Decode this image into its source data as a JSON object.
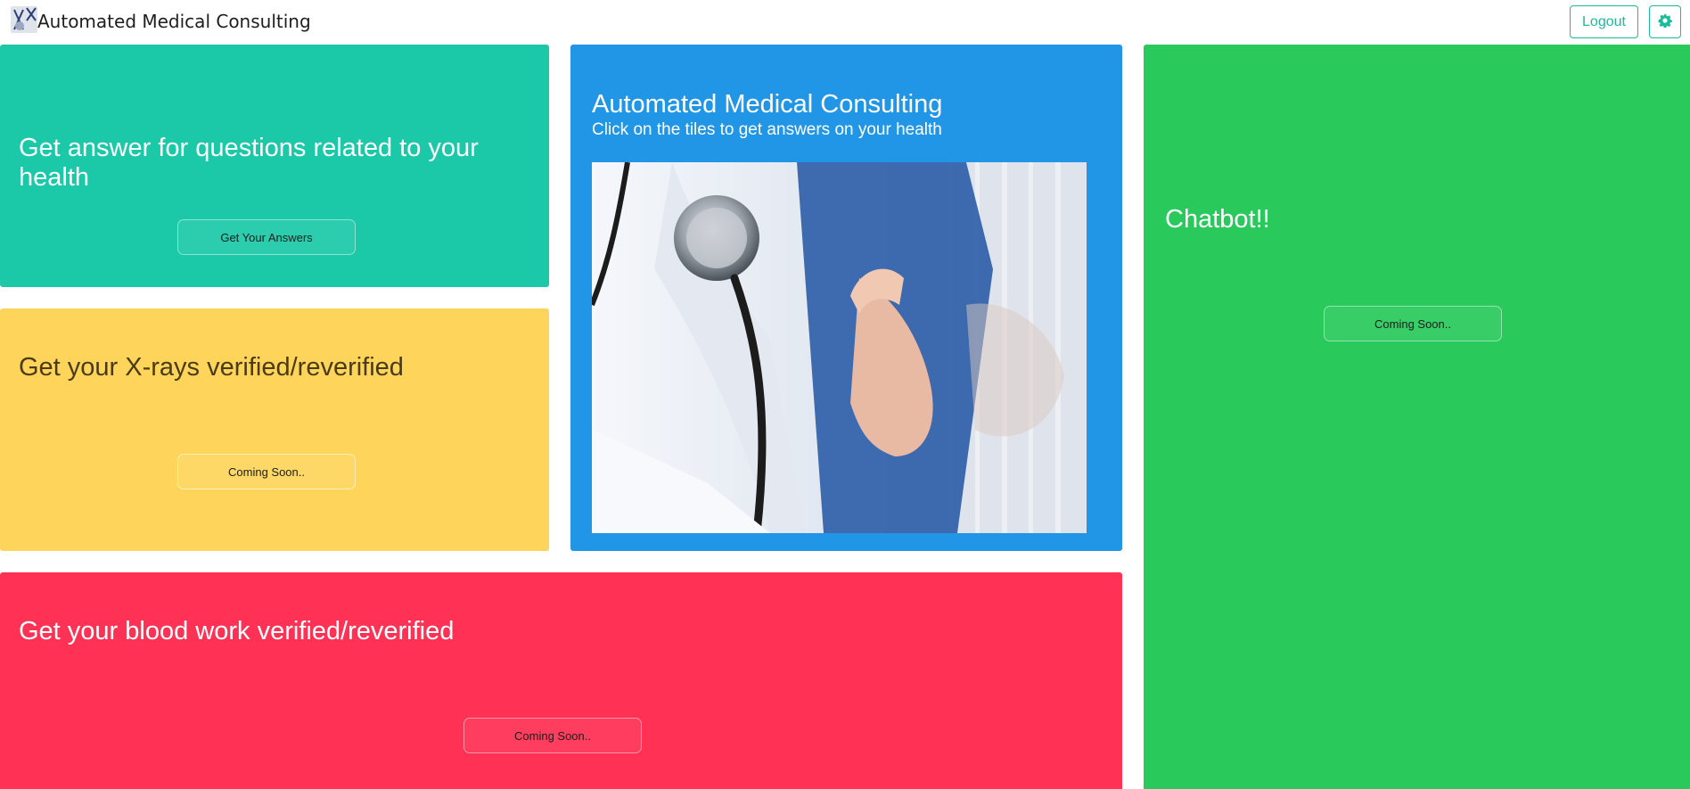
{
  "navbar": {
    "brand": "Automated Medical Consulting",
    "logout_label": "Logout",
    "settings_icon": "gear-icon",
    "accent_color": "#1abc9c"
  },
  "tiles": {
    "questions": {
      "title": "Get answer for questions related to your health",
      "button": "Get Your Answers",
      "color": "#1bc9a8"
    },
    "xrays": {
      "title": "Get your X-rays verified/reverified",
      "button": "Coming Soon..",
      "color": "#fed55a"
    },
    "intro": {
      "title": "Automated Medical Consulting",
      "subtitle": "Click on the tiles to get answers on your health",
      "color": "#2196e6"
    },
    "chatbot": {
      "title": "Chatbot!!",
      "button": "Coming Soon..",
      "color": "#29c95c"
    },
    "bloodwork": {
      "title": "Get your blood work verified/reverified",
      "button": "Coming Soon..",
      "color": "#ff3154"
    }
  }
}
